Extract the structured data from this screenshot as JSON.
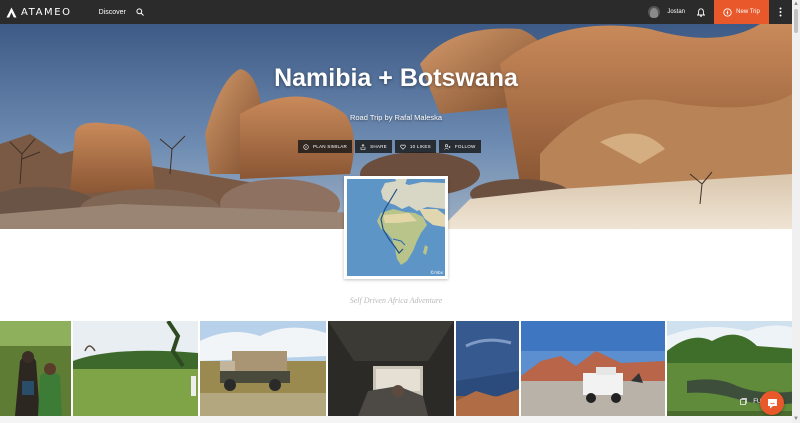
{
  "header": {
    "logo_text": "ATAMEO",
    "nav_discover": "Discover",
    "user_name": "Jostan",
    "new_trip_label": "New Trip"
  },
  "hero": {
    "title": "Namibia + Botswana",
    "subtitle": "Road Trip by Rafal Maleska",
    "actions": [
      {
        "label": "PLAN SIMILAR",
        "icon": "compass-icon"
      },
      {
        "label": "SHARE",
        "icon": "share-icon"
      },
      {
        "label": "10 LIKES",
        "icon": "heart-icon"
      },
      {
        "label": "FOLLOW",
        "icon": "follow-icon"
      }
    ]
  },
  "map": {
    "credit": "©mbx"
  },
  "trip": {
    "tagline": "Self Driven Africa Adventure"
  },
  "gallery": {
    "full_gallery_label": "FULL GA",
    "photos": [
      "people-photo",
      "savanna-photo",
      "truck-photo",
      "tent-photo",
      "sky-photo",
      "desert-photo",
      "river-photo"
    ]
  },
  "colors": {
    "accent": "#e8582a",
    "topbar": "#2b2b2b"
  }
}
